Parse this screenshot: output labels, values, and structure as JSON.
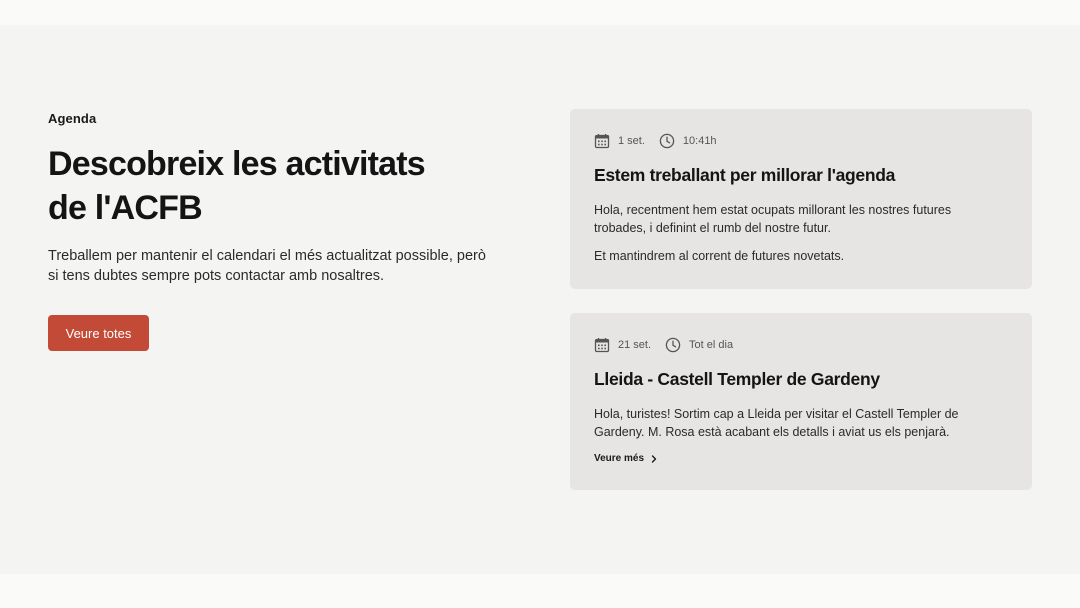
{
  "agenda": {
    "eyebrow": "Agenda",
    "title": "Descobreix les activitats de l'ACFB",
    "lead": "Treballem per mantenir el calendari el més actualitzat possible, però si tens dubtes sempre pots contactar amb nosaltres.",
    "button_label": "Veure totes"
  },
  "events": [
    {
      "date": "1 set.",
      "time": "10:41h",
      "title": "Estem treballant per millorar l'agenda",
      "paragraphs": [
        "Hola, recentment hem estat ocupats millorant les nostres futures trobades, i definint el rumb del nostre futur.",
        "Et mantindrem al corrent de futures novetats."
      ]
    },
    {
      "date": "21 set.",
      "time": "Tot el dia",
      "title": "Lleida - Castell Templer de Gardeny",
      "paragraphs": [
        "Hola, turistes! Sortim cap a Lleida per visitar el Castell Templer de Gardeny. M. Rosa està acabant els detalls i aviat us els penjarà."
      ],
      "more_label": "Veure més"
    }
  ],
  "icons": {
    "date": "calendar-icon",
    "time": "clock-icon",
    "more": "chevron-right-icon"
  },
  "colors": {
    "accent": "#c24a36",
    "section_bg": "#f4f4f3",
    "card_bg": "#e6e5e3"
  }
}
